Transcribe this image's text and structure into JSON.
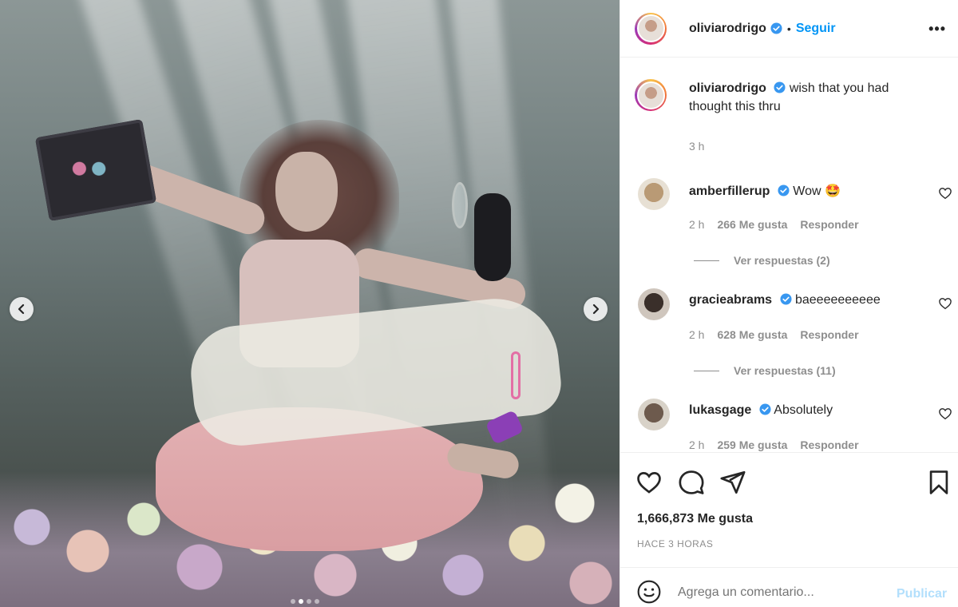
{
  "header": {
    "username": "oliviarodrigo",
    "separator": "•",
    "follow_label": "Seguir",
    "more_label": "•••"
  },
  "caption": {
    "username": "oliviarodrigo",
    "text": "wish that you had thought this thru",
    "time": "3 h"
  },
  "comments": [
    {
      "username": "amberfillerup",
      "text": "Wow 🤩",
      "time": "2 h",
      "likes": "266 Me gusta",
      "reply": "Responder",
      "view_replies": "Ver respuestas (2)"
    },
    {
      "username": "gracieabrams",
      "text": "baeeeeeeeeee",
      "time": "2 h",
      "likes": "628 Me gusta",
      "reply": "Responder",
      "view_replies": "Ver respuestas (11)"
    },
    {
      "username": "lukasgage",
      "text": "Absolutely",
      "time": "2 h",
      "likes": "259 Me gusta",
      "reply": "Responder",
      "view_replies": ""
    }
  ],
  "actions": {
    "likes": "1,666,873 Me gusta",
    "posted": "HACE 3 HORAS"
  },
  "composer": {
    "placeholder": "Agrega un comentario...",
    "post_label": "Publicar"
  },
  "media": {
    "carousel_pages": 4,
    "active_page": 1
  },
  "colors": {
    "accent": "#0095f6",
    "text": "#262626",
    "muted": "#8e8e8e",
    "post_disabled": "#b2dffc",
    "verified": "#3897f0"
  },
  "icons": [
    "chevron-left-icon",
    "chevron-right-icon",
    "verified-icon",
    "heart-icon",
    "comment-icon",
    "share-icon",
    "bookmark-icon",
    "emoji-icon",
    "more-icon"
  ]
}
